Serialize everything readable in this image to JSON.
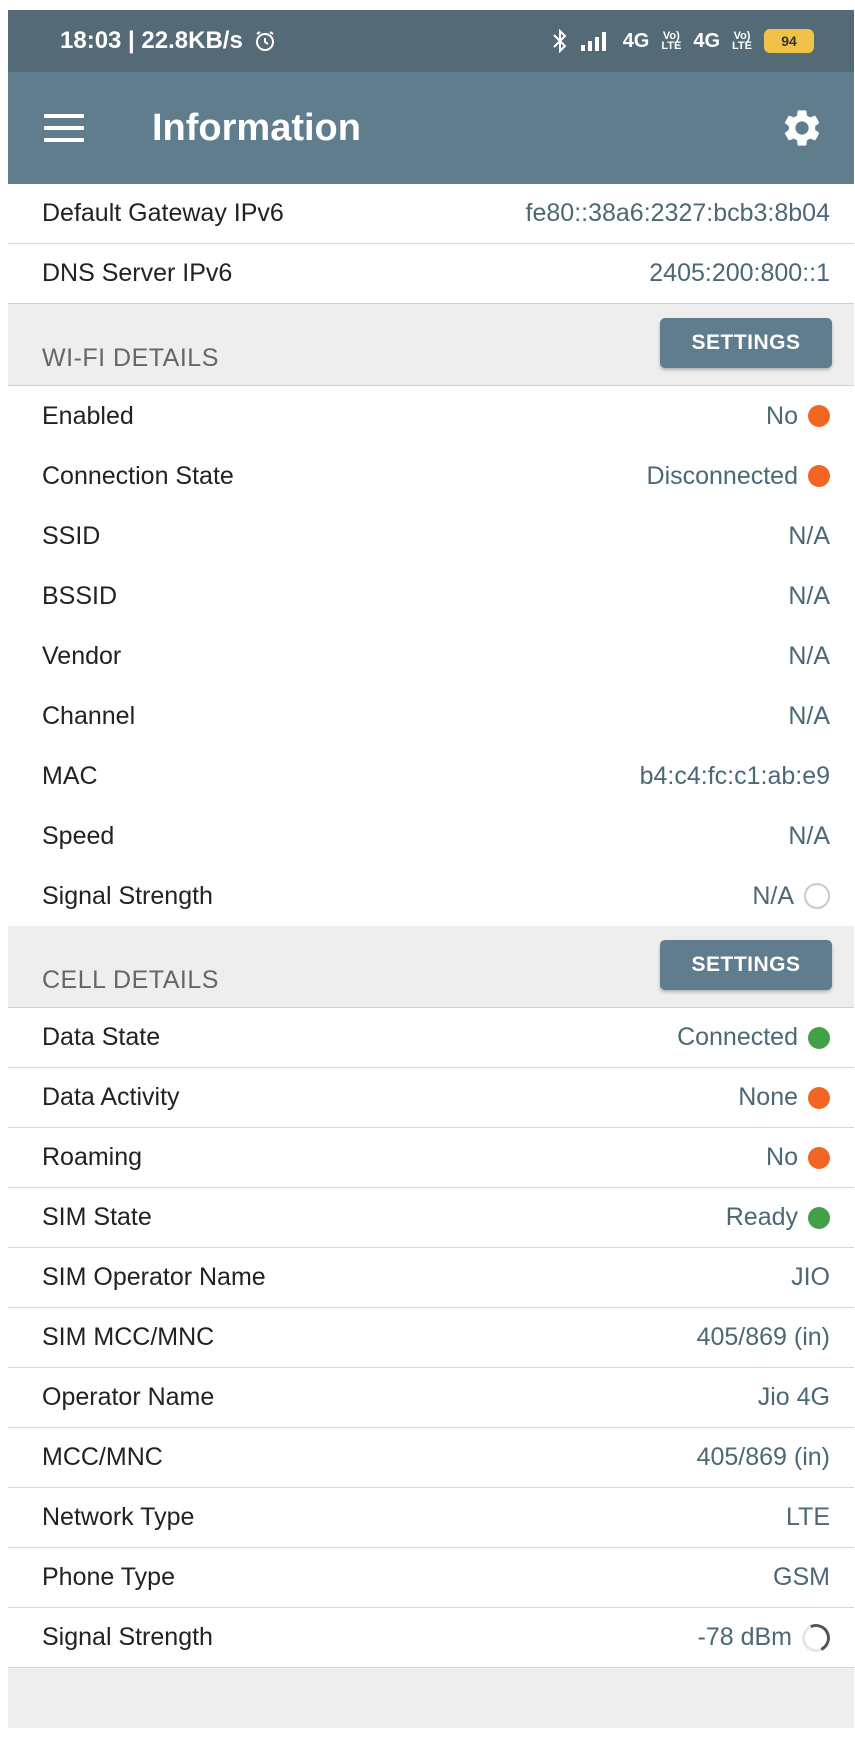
{
  "status_bar": {
    "time_speed": "18:03 | 22.8KB/s",
    "net1": "4G",
    "net2": "4G",
    "battery": "94"
  },
  "app_bar": {
    "title": "Information"
  },
  "top_rows": [
    {
      "label": "Default Gateway IPv6",
      "value": "fe80::38a6:2327:bcb3:8b04"
    },
    {
      "label": "DNS Server IPv6",
      "value": "2405:200:800::1"
    }
  ],
  "wifi": {
    "title": "WI-FI DETAILS",
    "button": "SETTINGS",
    "rows": [
      {
        "label": "Enabled",
        "value": "No",
        "indicator": "#f26522"
      },
      {
        "label": "Connection State",
        "value": "Disconnected",
        "indicator": "#f26522"
      },
      {
        "label": "SSID",
        "value": "N/A"
      },
      {
        "label": "BSSID",
        "value": "N/A"
      },
      {
        "label": "Vendor",
        "value": "N/A"
      },
      {
        "label": "Channel",
        "value": "N/A"
      },
      {
        "label": "MAC",
        "value": "b4:c4:fc:c1:ab:e9"
      },
      {
        "label": "Speed",
        "value": "N/A"
      },
      {
        "label": "Signal Strength",
        "value": "N/A"
      }
    ]
  },
  "cell": {
    "title": "CELL DETAILS",
    "button": "SETTINGS",
    "rows": [
      {
        "label": "Data State",
        "value": "Connected",
        "indicator": "#43a047"
      },
      {
        "label": "Data Activity",
        "value": "None",
        "indicator": "#f26522"
      },
      {
        "label": "Roaming",
        "value": "No",
        "indicator": "#f26522"
      },
      {
        "label": "SIM State",
        "value": "Ready",
        "indicator": "#43a047"
      },
      {
        "label": "SIM Operator Name",
        "value": "JIO"
      },
      {
        "label": "SIM MCC/MNC",
        "value": "405/869 (in)"
      },
      {
        "label": "Operator Name",
        "value": "Jio 4G"
      },
      {
        "label": "MCC/MNC",
        "value": "405/869 (in)"
      },
      {
        "label": "Network Type",
        "value": "LTE"
      },
      {
        "label": "Phone Type",
        "value": "GSM"
      },
      {
        "label": "Signal Strength",
        "value": "-78 dBm"
      }
    ]
  }
}
